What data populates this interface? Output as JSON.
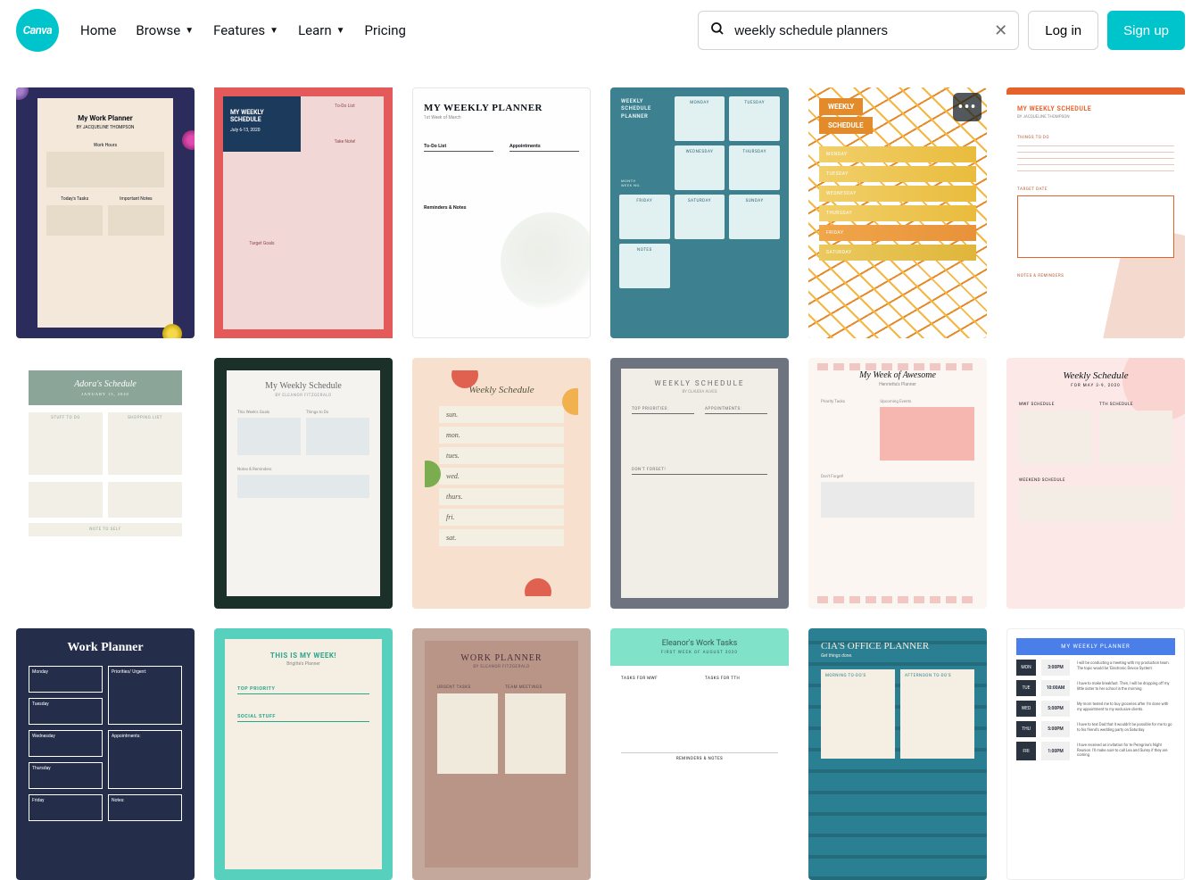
{
  "header": {
    "logo_text": "Canva",
    "nav": {
      "home": "Home",
      "browse": "Browse",
      "features": "Features",
      "learn": "Learn",
      "pricing": "Pricing"
    },
    "search_value": "weekly schedule planners",
    "login": "Log in",
    "signup": "Sign up"
  },
  "cards": {
    "c1": {
      "title": "My Work Planner",
      "subtitle": "BY JACQUELINE THOMPSON",
      "label1": "Work Hours",
      "label2": "Today's Tasks",
      "label3": "Important Notes"
    },
    "c2": {
      "title": "MY WEEKLY SCHEDULE",
      "subtitle": "July 6-13, 2020",
      "todo": "To-Do List",
      "goals": "Target Goals",
      "notes": "Take Note!"
    },
    "c3": {
      "title": "MY WEEKLY PLANNER",
      "subtitle": "1st Week of March",
      "col1": "To-Do List",
      "col2": "Appointments",
      "reminders": "Reminders & Notes"
    },
    "c4": {
      "title": "WEEKLY SCHEDULE PLANNER",
      "month": "MONTH",
      "week": "WEEK NO.",
      "days": [
        "MONDAY",
        "TUESDAY",
        "WEDNESDAY",
        "THURSDAY",
        "FRIDAY",
        "SATURDAY",
        "SUNDAY",
        "NOTES"
      ]
    },
    "c5": {
      "title1": "WEEKLY",
      "title2": "SCHEDULE",
      "days": [
        "MONDAY",
        "TUESDAY",
        "WEDNESDAY",
        "THURSDAY",
        "FRIDAY",
        "SATURDAY"
      ]
    },
    "c6": {
      "title": "MY WEEKLY SCHEDULE",
      "subtitle": "BY JACQUELINE THOMPSON",
      "label1": "THINGS TO DO",
      "label2": "TARGET DATE",
      "label3": "NOTES & REMINDERS"
    },
    "c7": {
      "title": "Adora's Schedule",
      "subtitle": "JANUARY 15, 2020",
      "col1": "STUFF TO DO",
      "col2": "SHOPPING LIST",
      "note": "NOTE TO SELF"
    },
    "c8": {
      "title": "My Weekly Schedule",
      "subtitle": "BY ELEANOR FITZGERALD",
      "col1": "This Week's Goals",
      "col2": "Things to Do",
      "footer": "Notes & Reminders"
    },
    "c9": {
      "title": "Weekly Schedule",
      "days": [
        "sun.",
        "mon.",
        "tues.",
        "wed.",
        "thurs.",
        "fri.",
        "sat."
      ]
    },
    "c10": {
      "title": "WEEKLY SCHEDULE",
      "subtitle": "BY CLAUDIA ALVES",
      "col1": "TOP PRIORITIES:",
      "col2": "APPOINTMENTS:",
      "dont": "DON'T FORGET!"
    },
    "c11": {
      "title": "My Week of Awesome",
      "subtitle": "Henrietta's Planner",
      "label1": "Priority Tasks",
      "label2": "Upcoming Events",
      "label3": "Don't Forget!"
    },
    "c12": {
      "title": "Weekly Schedule",
      "subtitle": "FOR MAY 3-9, 2020",
      "col1": "MWF SCHEDULE",
      "col2": "TTH SCHEDULE",
      "weekend": "WEEKEND SCHEDULE"
    },
    "c13": {
      "title": "Work Planner",
      "cells": [
        "Monday",
        "Priorities/ Urgent:",
        "Tuesday",
        "Wednesday",
        "Appointments:",
        "Thursday",
        "Friday",
        "Notes:"
      ]
    },
    "c14": {
      "title": "THIS IS MY WEEK!",
      "subtitle": "Brigitte's Planner",
      "sec1": "TOP PRIORITY",
      "sec2": "SOCIAL STUFF"
    },
    "c15": {
      "title": "WORK PLANNER",
      "subtitle": "BY ELEANOR FITZGERALD",
      "col1": "URGENT TASKS",
      "col2": "TEAM MEETINGS"
    },
    "c16": {
      "title": "Eleanor's Work Tasks",
      "subtitle": "FIRST WEEK OF AUGUST 2020",
      "col1": "TASKS FOR MWF",
      "col2": "TASKS FOR TTH",
      "footer": "REMINDERS & NOTES"
    },
    "c17": {
      "title": "CIA'S OFFICE PLANNER",
      "subtitle": "Get things done.",
      "col1": "MORNING TO-DO'S",
      "col2": "AFTERNOON TO-DO'S"
    },
    "c18": {
      "title": "MY WEEKLY PLANNER",
      "rows": [
        {
          "day": "MON",
          "time": "3:00PM",
          "text": "I will be conducting a meeting with my production team. The topic would be 'Electronic Device System'."
        },
        {
          "day": "TUE",
          "time": "10:00AM",
          "text": "I have to make breakfast. Then, I will be dropping off my little sister to her school in the morning."
        },
        {
          "day": "WED",
          "time": "5:00PM",
          "text": "My mom texted me to buy groceries after I'm done with my appointment to my exclusive clients."
        },
        {
          "day": "THU",
          "time": "5:00PM",
          "text": "I have to text Dad that it wouldn't be possible for me to go to his friend's wedding party on Saturday."
        },
        {
          "day": "FRI",
          "time": "1:00PM",
          "text": "I have received an invitation for te Peregrine's Night Reunion. I'll make sure to call Lea and Sunny if they are coming."
        }
      ]
    }
  }
}
